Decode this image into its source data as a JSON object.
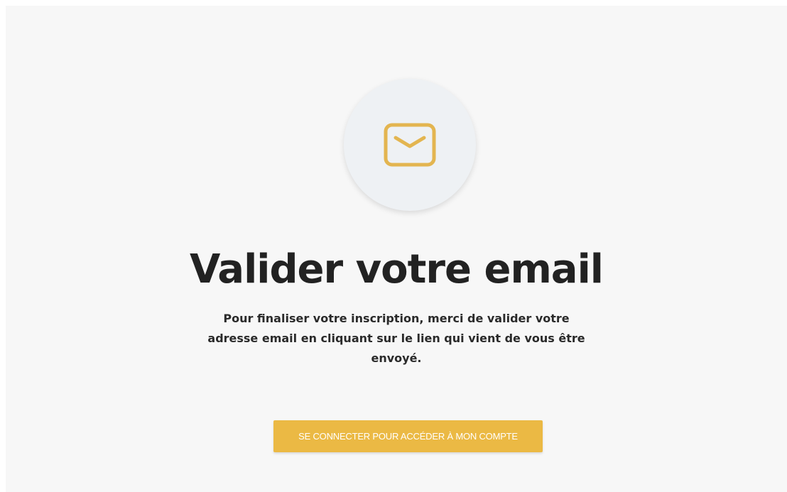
{
  "icon": {
    "name": "envelope-icon",
    "color": "#e3b550"
  },
  "heading": "Valider votre email",
  "description": "Pour finaliser votre inscription, merci de valider votre adresse email en cliquant sur le lien qui vient de vous être envoyé.",
  "cta": {
    "label": "SE CONNECTER POUR ACCÉDER À MON COMPTE",
    "color": "#ebb944"
  },
  "colors": {
    "background": "#f7f7f7",
    "circle": "#eef1f4",
    "text": "#222222"
  }
}
